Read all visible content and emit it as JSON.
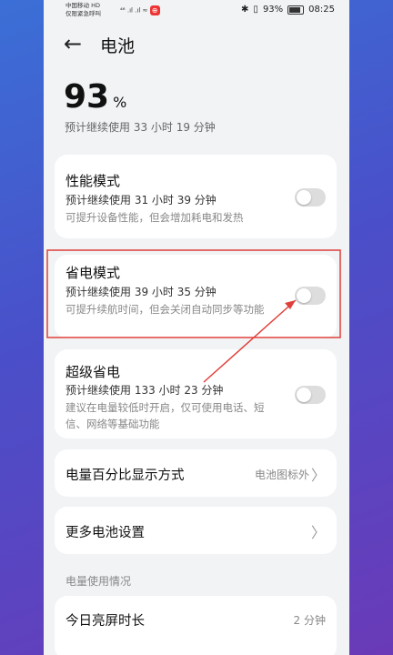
{
  "status_bar": {
    "carrier_line1": "中国移动 HD",
    "carrier_line2": "仅限紧急呼叫",
    "signal_text": "⁴⁶ .ıl .ıl ≈",
    "app_badge": "⊕",
    "bluetooth": "✱",
    "vibrate": "▯",
    "battery_pct": "93%",
    "time": "08:25"
  },
  "header": {
    "back_glyph": "←",
    "title": "电池"
  },
  "battery": {
    "level": "93",
    "unit": "%",
    "estimate": "预计继续使用 33 小时 19 分钟"
  },
  "modes": [
    {
      "title": "性能模式",
      "subtitle": "预计继续使用 31 小时 39 分钟",
      "desc": "可提升设备性能，但会增加耗电和发热",
      "enabled": false
    },
    {
      "title": "省电模式",
      "subtitle": "预计继续使用 39 小时 35 分钟",
      "desc": "可提升续航时间，但会关闭自动同步等功能",
      "enabled": false
    },
    {
      "title": "超级省电",
      "subtitle": "预计继续使用 133 小时 23 分钟",
      "desc": "建议在电量较低时开启，仅可使用电话、短信、网络等基础功能",
      "enabled": false
    }
  ],
  "settings": {
    "percent_display": {
      "label": "电量百分比显示方式",
      "value": "电池图标外"
    },
    "more": {
      "label": "更多电池设置"
    }
  },
  "usage": {
    "section_title": "电量使用情况",
    "screen_time_label": "今日亮屏时长",
    "screen_time_value": "2 分钟"
  },
  "chevron_glyph": "〉",
  "colors": {
    "highlight": "#e0403a",
    "background_gradient": [
      "#3b6fd6",
      "#6a3ab8"
    ]
  }
}
